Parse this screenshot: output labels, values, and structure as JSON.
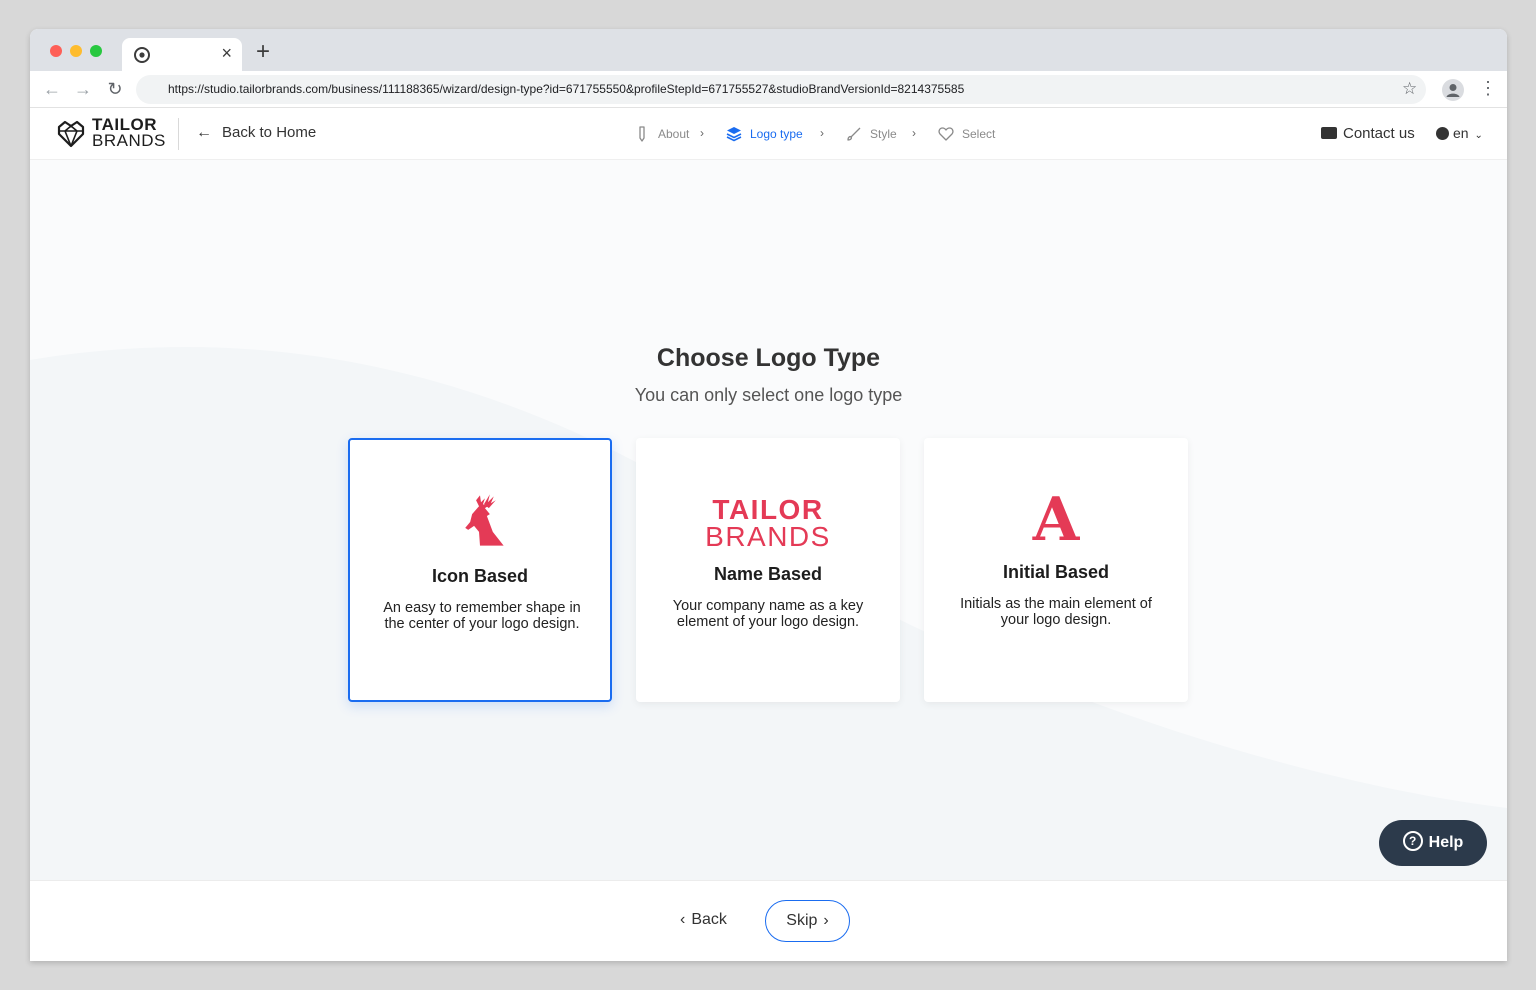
{
  "browser": {
    "tab_close": "×",
    "new_tab": "+",
    "url": "https://studio.tailorbrands.com/business/111188365/wizard/design-type?id=671755550&profileStepId=671755527&studioBrandVersionId=8214375585",
    "back_glyph": "←",
    "forward_glyph": "→",
    "reload_glyph": "↻",
    "star_glyph": "☆",
    "menu_glyph": "⋮"
  },
  "header": {
    "logo_line1": "TAILOR",
    "logo_line2": "BRANDS",
    "back_home": "Back to Home",
    "steps": [
      {
        "label": "About",
        "active": false
      },
      {
        "label": "Logo type",
        "active": true
      },
      {
        "label": "Style",
        "active": false
      },
      {
        "label": "Select",
        "active": false
      }
    ],
    "contact": "Contact us",
    "language": "en"
  },
  "main": {
    "title": "Choose Logo Type",
    "subtitle": "You can only select one logo type",
    "cards": [
      {
        "title": "Icon Based",
        "description": "An easy to remember shape in the center of your logo design.",
        "selected": true
      },
      {
        "title": "Name Based",
        "description": "Your company name as a key element of your logo design.",
        "art_line1": "TAILOR",
        "art_line2": "BRANDS",
        "selected": false
      },
      {
        "title": "Initial Based",
        "description": "Initials as the main element of your logo design.",
        "art_letter": "A",
        "selected": false
      }
    ]
  },
  "help": {
    "label": "Help",
    "glyph": "?"
  },
  "footer": {
    "back": "Back",
    "skip": "Skip",
    "back_chevron": "‹",
    "skip_chevron": "›"
  },
  "colors": {
    "accent": "#1a6cf0",
    "brand_red": "#e43a56",
    "help_bg": "#2c3a4b"
  }
}
